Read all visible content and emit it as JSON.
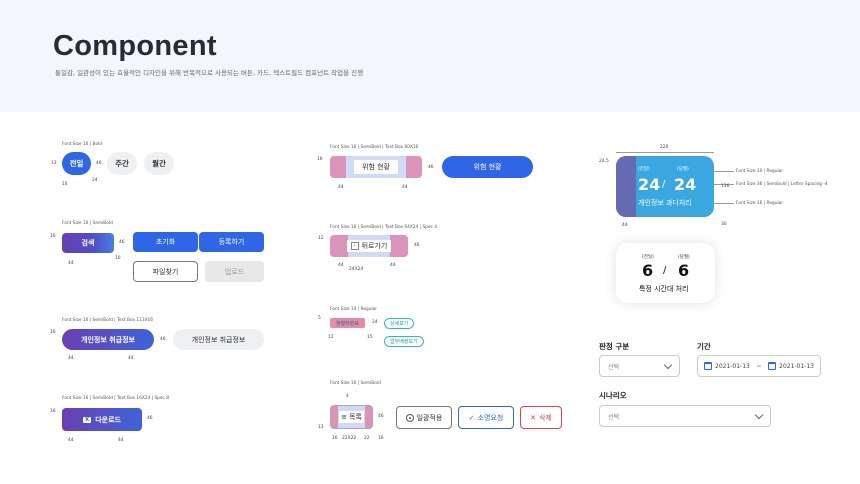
{
  "header": {
    "title": "Component",
    "subtitle": "통일감, 일관성이 있는 효율적인 디자인을 위해 반복적으로 사용되는 버튼, 카드, 텍스트필드 컴포넌트 작업을 진행"
  },
  "col1": {
    "tabs": {
      "spec": "Font Size 16 | Bold",
      "items": [
        "전일",
        "주간",
        "월간"
      ],
      "dims": [
        "13",
        "46",
        "16",
        "24"
      ]
    },
    "buttons": {
      "spec": "Font Size 16 | SemiBold",
      "search": "검색",
      "reset": "초기화",
      "register": "등록하기",
      "file": "파일찾기",
      "upload": "업로드",
      "dims": [
        "16",
        "46",
        "44",
        "10"
      ]
    },
    "privacy": {
      "spec": "Font Size 16 | SemiBold | Text Box 113X16",
      "label": "개인정보 취급정보",
      "label2": "개인정보 취급정보",
      "dims": [
        "16",
        "46",
        "44",
        "44"
      ]
    },
    "download": {
      "spec": "Font Size 16 | SemiBold | Text Box 16X24 | Spec 8",
      "label": "다운로드",
      "icon_text": "X",
      "dims": [
        "16",
        "46",
        "44",
        "44"
      ]
    }
  },
  "col2": {
    "risk": {
      "spec": "Font Size 16 | SemiBold | Text Box 60X16",
      "label": "위험 현황",
      "label2": "위험 현황",
      "dims": [
        "16",
        "46",
        "44",
        "44"
      ]
    },
    "back": {
      "spec": "Font Size 16 | SemiBold | Text Box 64X24 | Spec 4",
      "label": "뒤로가기",
      "dims": [
        "12",
        "46",
        "44",
        "24X24",
        "44"
      ]
    },
    "tags": {
      "spec": "Font Size 14 | Regular",
      "sample": "현황자원표",
      "items": [
        "상세보기",
        "업무배정보기"
      ],
      "dims": [
        "5",
        "24",
        "12",
        "15"
      ]
    },
    "list": {
      "spec": "Font Size 16 | SemiBold",
      "label": "목록",
      "bulk": "일괄적용",
      "request": "소명요청",
      "delete": "삭제",
      "dims": [
        "4",
        "46",
        "13",
        "16",
        "22X22",
        "22",
        "16"
      ]
    }
  },
  "col3": {
    "card": {
      "width": "220",
      "height": "24.5",
      "date1": "(전일)",
      "date2": "(당월)",
      "num1": "24",
      "num2": "24",
      "slash": "/",
      "caption": "개인정보 과다처리",
      "notes": [
        "Font Size 10 | Regular",
        "Font Size 36 | Semibold | Letter Spacing -4",
        "Font Size 16 | Regular"
      ],
      "dims": [
        "136",
        "44",
        "30"
      ]
    },
    "card2": {
      "date1": "(전일)",
      "date2": "(당월)",
      "num1": "6",
      "num2": "6",
      "slash": "/",
      "caption": "특정 시간대 처리"
    },
    "form": {
      "type_label": "판정 구분",
      "type_placeholder": "선택",
      "period_label": "기간",
      "date_from": "2021-01-13",
      "date_sep": "~",
      "date_to": "2021-01-13",
      "scenario_label": "시나리오",
      "scenario_placeholder": "선택"
    }
  }
}
